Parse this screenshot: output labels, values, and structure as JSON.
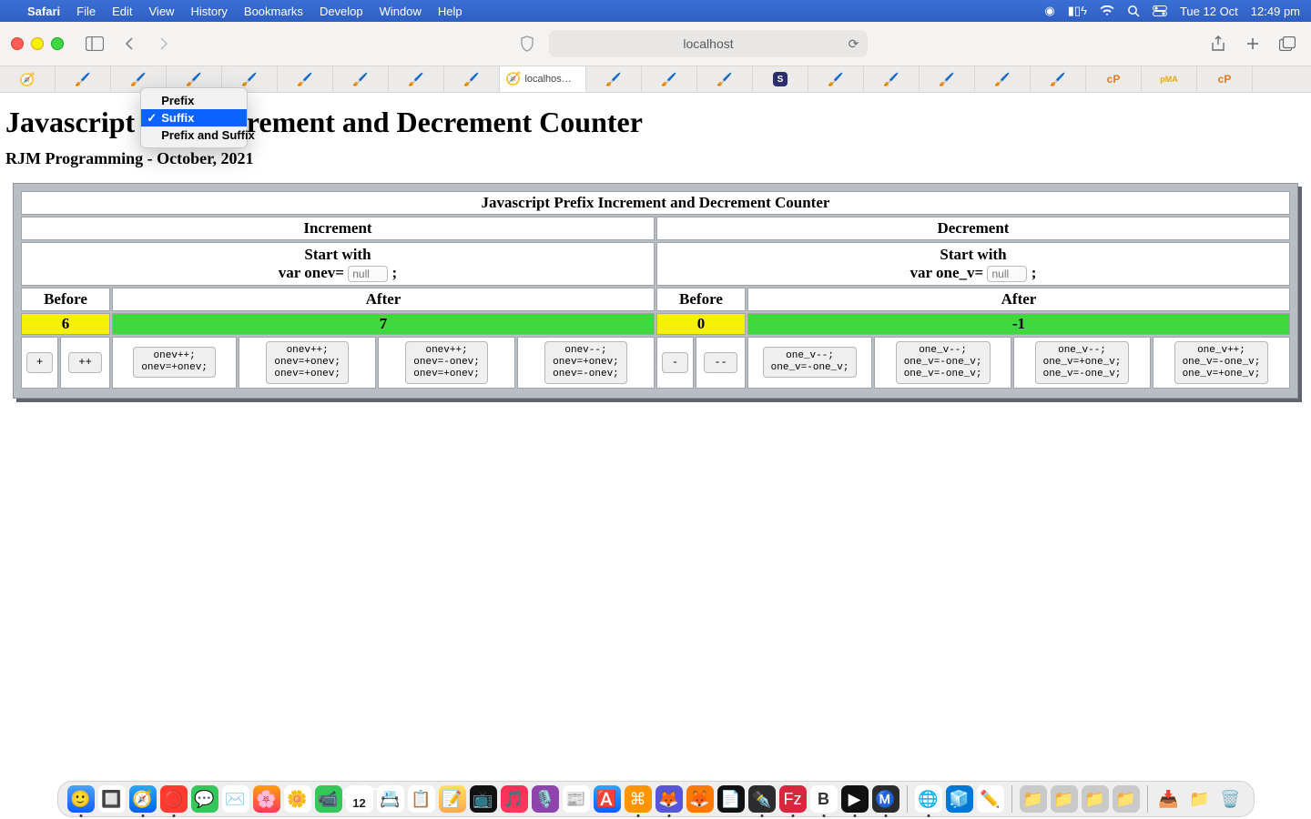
{
  "menubar": {
    "app": "Safari",
    "items": [
      "File",
      "Edit",
      "View",
      "History",
      "Bookmarks",
      "Develop",
      "Window",
      "Help"
    ],
    "date": "Tue 12 Oct",
    "time": "12:49 pm"
  },
  "toolbar": {
    "address": "localhost"
  },
  "tabs": {
    "active_label": "localhos…"
  },
  "page": {
    "h1_before": "Javascript",
    "h1_after": "Increment and Decrement Counter",
    "subtitle": "RJM Programming - October, 2021",
    "select": {
      "options": [
        "Prefix",
        "Suffix",
        "Prefix and Suffix"
      ],
      "selected": "Suffix"
    }
  },
  "table": {
    "caption": "Javascript Prefix Increment and Decrement Counter",
    "heads": {
      "inc": "Increment",
      "dec": "Decrement",
      "start": "Start with",
      "before": "Before",
      "after": "After"
    },
    "start_inc_label": "var onev=",
    "start_inc_value": "null",
    "start_dec_label": "var one_v=",
    "start_dec_value": "null",
    "semicolon": ";",
    "vals": {
      "inc_before": "6",
      "inc_after": "7",
      "dec_before": "0",
      "dec_after": "-1"
    },
    "buttons": {
      "b1": "+",
      "b2": "++",
      "b3": "onev++;\nonev=+onev;",
      "b4": "onev++;\nonev=+onev;\nonev=+onev;",
      "b5": "onev++;\nonev=-onev;\nonev=+onev;",
      "b6": "onev--;\nonev=+onev;\nonev=-onev;",
      "b7": "-",
      "b8": "--",
      "b9": "one_v--;\none_v=-one_v;",
      "b10": "one_v--;\none_v=-one_v;\none_v=-one_v;",
      "b11": "one_v--;\none_v=+one_v;\none_v=-one_v;",
      "b12": "one_v++;\none_v=-one_v;\none_v=+one_v;"
    }
  },
  "dock": {
    "cal_month": "OCT",
    "cal_day": "12"
  }
}
